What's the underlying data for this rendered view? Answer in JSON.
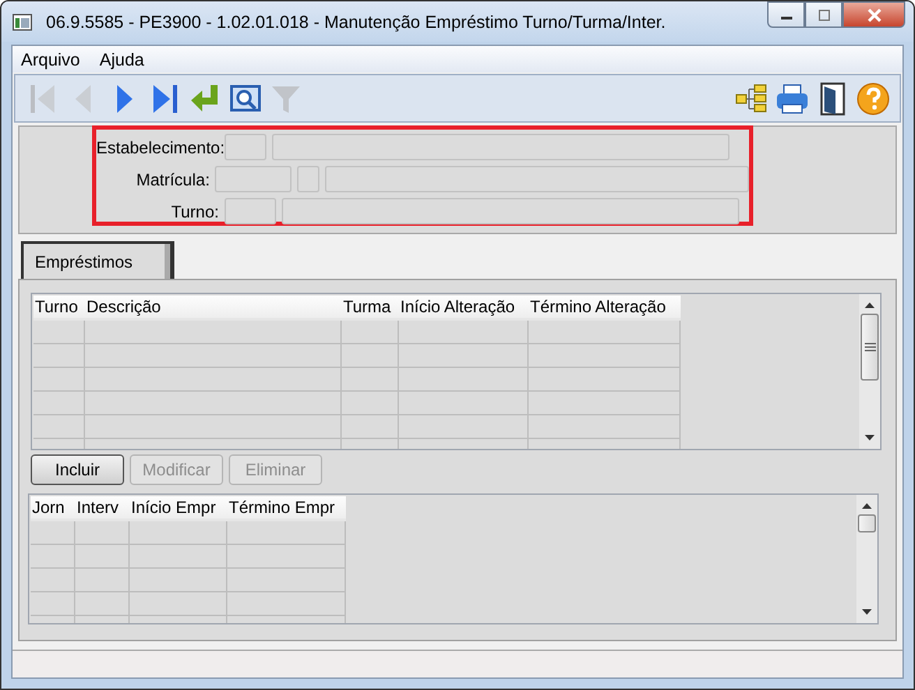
{
  "window": {
    "title": "06.9.5585 - PE3900 - 1.02.01.018 - Manutenção Empréstimo Turno/Turma/Inter."
  },
  "menu": [
    "Arquivo",
    "Ajuda"
  ],
  "toolbar": {
    "left": [
      {
        "kind": "first",
        "disabled": true
      },
      {
        "kind": "prev",
        "disabled": true
      },
      {
        "kind": "next",
        "disabled": false
      },
      {
        "kind": "last",
        "disabled": false
      },
      {
        "kind": "enter",
        "disabled": false
      },
      {
        "kind": "zoom",
        "disabled": false
      },
      {
        "kind": "filter",
        "disabled": true
      }
    ],
    "right": [
      {
        "kind": "tree"
      },
      {
        "kind": "print"
      },
      {
        "kind": "exit"
      },
      {
        "kind": "help"
      }
    ]
  },
  "filter": {
    "highlighted": true,
    "rows": [
      {
        "label": "Estabelecimento:",
        "fields": [
          {
            "kind": "short"
          },
          {
            "kind": "long"
          }
        ]
      },
      {
        "label": "Matrícula:",
        "fields": [
          {
            "kind": "medium"
          },
          {
            "kind": "tiny"
          },
          {
            "kind": "long"
          }
        ]
      },
      {
        "label": "Turno:",
        "fields": [
          {
            "kind": "short2"
          },
          {
            "kind": "long"
          }
        ]
      }
    ]
  },
  "tabs": [
    {
      "label": "Empréstimos",
      "selected": true
    }
  ],
  "loans_table": {
    "columns": [
      "Turno",
      "Descrição",
      "Turma",
      "Início Alteração",
      "Término Alteração"
    ]
  },
  "buttons": [
    {
      "label": "Incluir",
      "disabled": false
    },
    {
      "label": "Modificar",
      "disabled": true
    },
    {
      "label": "Eliminar",
      "disabled": true
    }
  ],
  "breaks_table": {
    "columns": [
      "Jorn",
      "Interv",
      "Início Empr",
      "Término Empr"
    ]
  }
}
